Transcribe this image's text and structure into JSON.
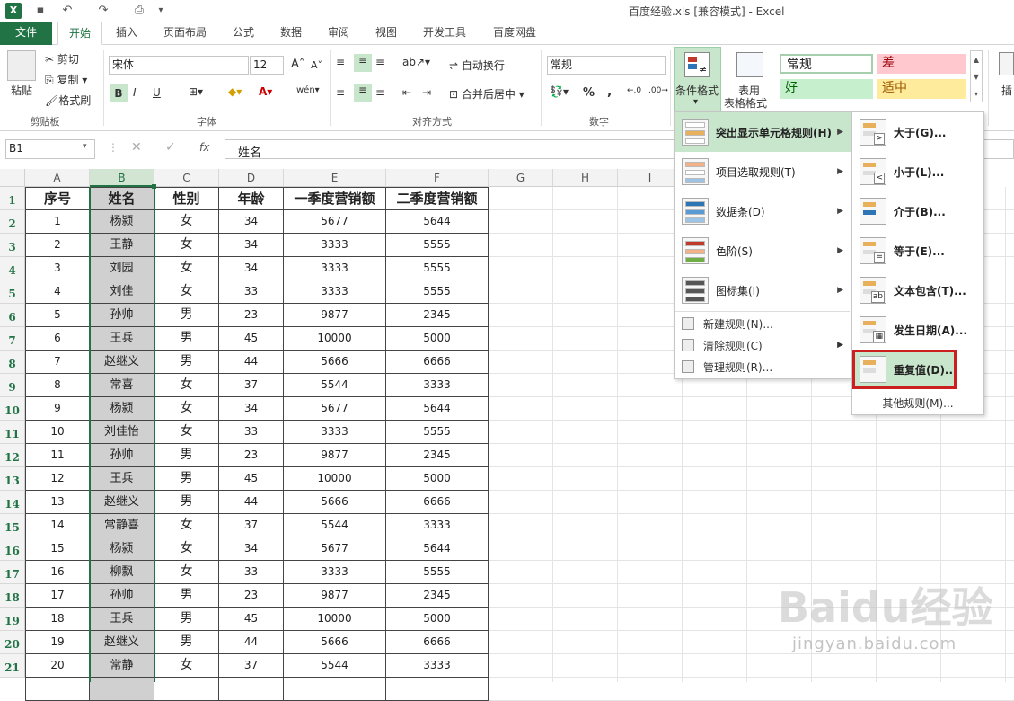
{
  "app": {
    "title": "百度经验.xls  [兼容模式] - Excel"
  },
  "tabs": [
    "文件",
    "开始",
    "插入",
    "页面布局",
    "公式",
    "数据",
    "审阅",
    "视图",
    "开发工具",
    "百度网盘"
  ],
  "clipboard": {
    "paste": "粘贴",
    "cut": "剪切",
    "copy": "复制",
    "painter": "格式刷",
    "group": "剪贴板"
  },
  "font": {
    "name": "宋体",
    "size": "12",
    "group": "字体",
    "bold": "B",
    "italic": "I",
    "underline": "U"
  },
  "align": {
    "wrap": "自动换行",
    "merge": "合并后居中",
    "group": "对齐方式"
  },
  "number": {
    "format": "常规",
    "percent": "%",
    "comma": ",",
    "group": "数字"
  },
  "styles": {
    "cond": "条件格式",
    "table_line1": "表用",
    "table_line2": "表格格式",
    "normal": "常规",
    "bad": "差",
    "good": "好",
    "neutral": "适中",
    "insert": "插"
  },
  "formula_bar": {
    "name_box": "B1",
    "fx": "fx",
    "value": "姓名"
  },
  "col_headers": [
    "A",
    "B",
    "C",
    "D",
    "E",
    "F",
    "G",
    "H",
    "I"
  ],
  "row_headers": [
    "1",
    "2",
    "3",
    "4",
    "5",
    "6",
    "7",
    "8",
    "9",
    "10",
    "11",
    "12",
    "13",
    "14",
    "15",
    "16",
    "17",
    "18",
    "19",
    "20",
    "21"
  ],
  "table": {
    "headers": [
      "序号",
      "姓名",
      "性别",
      "年龄",
      "一季度营销额",
      "二季度营销额"
    ],
    "rows": [
      [
        "1",
        "杨颍",
        "女",
        "34",
        "5677",
        "5644"
      ],
      [
        "2",
        "王静",
        "女",
        "34",
        "3333",
        "5555"
      ],
      [
        "3",
        "刘园",
        "女",
        "34",
        "3333",
        "5555"
      ],
      [
        "4",
        "刘佳",
        "女",
        "33",
        "3333",
        "5555"
      ],
      [
        "5",
        "孙帅",
        "男",
        "23",
        "9877",
        "2345"
      ],
      [
        "6",
        "王兵",
        "男",
        "45",
        "10000",
        "5000"
      ],
      [
        "7",
        "赵继义",
        "男",
        "44",
        "5666",
        "6666"
      ],
      [
        "8",
        "常喜",
        "女",
        "37",
        "5544",
        "3333"
      ],
      [
        "9",
        "杨颍",
        "女",
        "34",
        "5677",
        "5644"
      ],
      [
        "10",
        "刘佳怡",
        "女",
        "33",
        "3333",
        "5555"
      ],
      [
        "11",
        "孙帅",
        "男",
        "23",
        "9877",
        "2345"
      ],
      [
        "12",
        "王兵",
        "男",
        "45",
        "10000",
        "5000"
      ],
      [
        "13",
        "赵继义",
        "男",
        "44",
        "5666",
        "6666"
      ],
      [
        "14",
        "常静喜",
        "女",
        "37",
        "5544",
        "3333"
      ],
      [
        "15",
        "杨颍",
        "女",
        "34",
        "5677",
        "5644"
      ],
      [
        "16",
        "柳飘",
        "女",
        "33",
        "3333",
        "5555"
      ],
      [
        "17",
        "孙帅",
        "男",
        "23",
        "9877",
        "2345"
      ],
      [
        "18",
        "王兵",
        "男",
        "45",
        "10000",
        "5000"
      ],
      [
        "19",
        "赵继义",
        "男",
        "44",
        "5666",
        "6666"
      ],
      [
        "20",
        "常静",
        "女",
        "37",
        "5544",
        "3333"
      ]
    ]
  },
  "cf_menu": {
    "items": [
      "突出显示单元格规则(H)",
      "项目选取规则(T)",
      "数据条(D)",
      "色阶(S)",
      "图标集(I)"
    ],
    "small": [
      "新建规则(N)...",
      "清除规则(C)",
      "管理规则(R)..."
    ]
  },
  "submenu": {
    "items": [
      "大于(G)...",
      "小于(L)...",
      "介于(B)...",
      "等于(E)...",
      "文本包含(T)...",
      "发生日期(A)...",
      "重复值(D)..."
    ],
    "more": "其他规则(M)..."
  },
  "watermark": {
    "brand": "Baidu经验",
    "url": "jingyan.baidu.com"
  },
  "colors": {
    "excel_green": "#217346",
    "highlight": "#c8e6cc",
    "red_box": "#cc1f1f"
  }
}
